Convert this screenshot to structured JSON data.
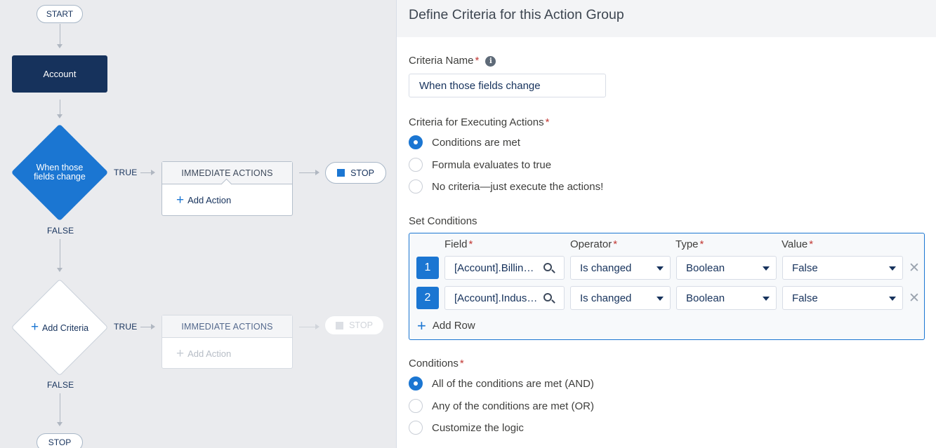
{
  "flow": {
    "start_label": "START",
    "object_label": "Account",
    "criteria1_label_line1": "When those",
    "criteria1_label_line2": "fields change",
    "true_label": "TRUE",
    "false_label": "FALSE",
    "immediate_actions_label": "IMMEDIATE ACTIONS",
    "add_action_label": "Add Action",
    "stop_label": "STOP",
    "add_criteria_label": "Add Criteria",
    "plus_glyph": "+"
  },
  "panel": {
    "title": "Define Criteria for this Action Group",
    "criteria_name_label": "Criteria Name",
    "criteria_name_value": "When those fields change",
    "required_mark": "*",
    "info_glyph": "i",
    "executing_label": "Criteria for Executing Actions",
    "executing_options": [
      "Conditions are met",
      "Formula evaluates to true",
      "No criteria—just execute the actions!"
    ],
    "executing_selected": 0,
    "set_conditions_label": "Set Conditions",
    "columns": {
      "field": "Field",
      "operator": "Operator",
      "type": "Type",
      "value": "Value"
    },
    "rows": [
      {
        "num": "1",
        "field": "[Account].BillingAddress",
        "operator": "Is changed",
        "type": "Boolean",
        "value": "False"
      },
      {
        "num": "2",
        "field": "[Account].Industry",
        "operator": "Is changed",
        "type": "Boolean",
        "value": "False"
      }
    ],
    "remove_glyph": "✕",
    "add_row_label": "Add Row",
    "conditions_label": "Conditions",
    "conditions_options": [
      "All of the conditions are met (AND)",
      "Any of the conditions are met (OR)",
      "Customize the logic"
    ],
    "conditions_selected": 0
  },
  "colors": {
    "accent": "#1b76d2",
    "node_dark": "#16325c",
    "canvas_bg": "#eaebee",
    "required": "#c23934"
  },
  "icons": [
    "info-icon",
    "search-icon",
    "caret-down-icon",
    "close-icon",
    "plus-icon",
    "stop-square-icon"
  ]
}
